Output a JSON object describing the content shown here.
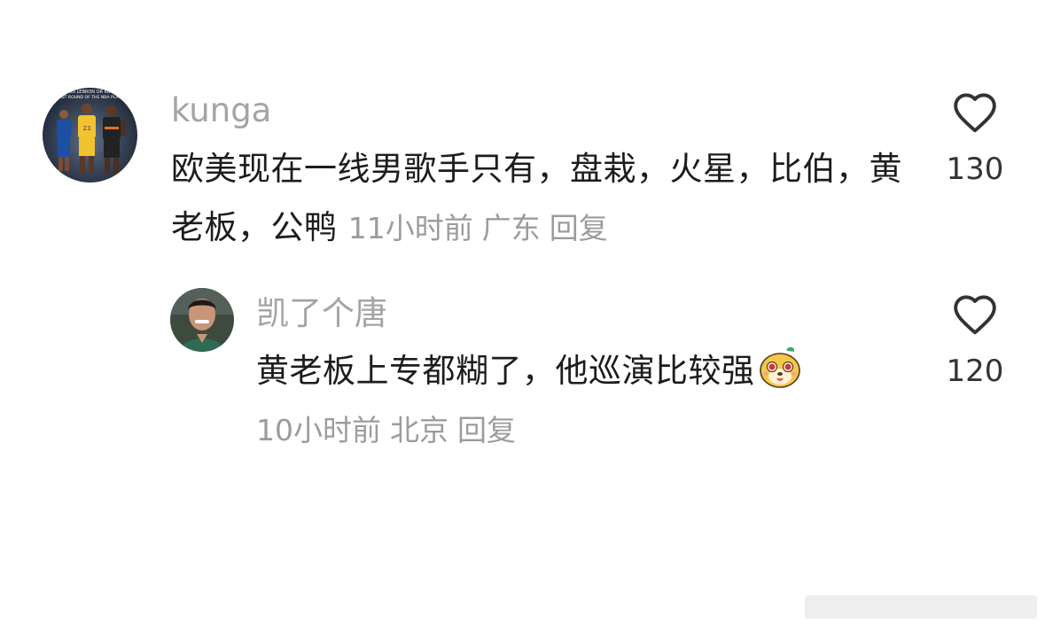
{
  "comments": [
    {
      "username": "kunga",
      "text": "欧美现在一线男歌手只有，盘栽，火星，比伯，黄老板，公鸭",
      "time": "11小时前",
      "location": "广东",
      "reply_label": "回复",
      "likes": "130",
      "avatar_icon": "nba-players-avatar",
      "avatar_caption": "ON LEBRON OR KD FIRST ROUND OF THE NBA PLAYO"
    },
    {
      "username": "凯了个唐",
      "text": "黄老板上专都糊了，他巡演比较强",
      "emoji_icon": "cute-dog-emoji",
      "time": "10小时前",
      "location": "北京",
      "reply_label": "回复",
      "likes": "120",
      "avatar_icon": "person-photo-avatar"
    }
  ],
  "colors": {
    "username": "#a4a4a4",
    "text": "#1c1c1c",
    "meta": "#9c9c9c",
    "like_count": "#333333",
    "heart_outline": "#333333"
  }
}
